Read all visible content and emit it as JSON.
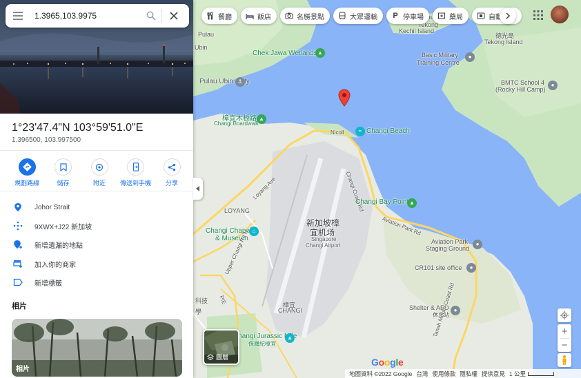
{
  "search": {
    "value": "1.3965,103.9975"
  },
  "place": {
    "title": "1°23'47.4\"N 103°59'51.0\"E",
    "decimal": "1.396500, 103.997500"
  },
  "actions": [
    {
      "label": "規劃路線",
      "icon": "directions-icon"
    },
    {
      "label": "儲存",
      "icon": "bookmark-icon"
    },
    {
      "label": "附近",
      "icon": "nearby-icon"
    },
    {
      "label": "傳送到手機",
      "icon": "send-to-phone-icon"
    },
    {
      "label": "分享",
      "icon": "share-icon"
    }
  ],
  "info": [
    {
      "text": "Johor Strait",
      "icon": "location-pin-icon"
    },
    {
      "text": "9XWX+J22 新加坡",
      "icon": "plus-code-icon"
    },
    {
      "text": "新增遺漏的地點",
      "icon": "add-place-icon"
    },
    {
      "text": "加入你的商家",
      "icon": "add-business-icon"
    },
    {
      "text": "新增標籤",
      "icon": "label-icon"
    }
  ],
  "photos": {
    "heading": "相片",
    "thumb_label": "相片"
  },
  "chips": [
    {
      "label": "餐廳",
      "icon": "restaurant-icon"
    },
    {
      "label": "飯店",
      "icon": "hotel-icon"
    },
    {
      "label": "名勝景點",
      "icon": "camera-icon"
    },
    {
      "label": "大眾運輸",
      "icon": "transit-icon"
    },
    {
      "label": "停車場",
      "icon": "parking-icon"
    },
    {
      "label": "藥局",
      "icon": "pharmacy-icon"
    },
    {
      "label": "自動提款",
      "icon": "atm-icon"
    }
  ],
  "map_labels": {
    "pulau_ubin_1": "Pulau",
    "pulau_ubin_2": "Ubin",
    "tekong_kechil_1": "Pulau",
    "tekong_kechil_2": "Tekong",
    "tekong_kechil_3": "Kechil Island",
    "tekong_cn": "德光島",
    "tekong_en": "Tekong Island",
    "chek_jawa": "Chek Jawa Wetlands",
    "ubin_jetty": "Pulau Ubin Jetty",
    "basic_military_1": "Basic Military",
    "basic_military_2": "Training Centre",
    "bmtc_1": "BMTC School 4",
    "bmtc_2": "(Rocky Hill Camp)",
    "boardwalk_cn": "樟宜木板路",
    "boardwalk_en": "Changi Boardwalk",
    "changi_beach": "Changi Beach",
    "nicoll": "Nicoll",
    "changi_coast": "Changi Coast Rd",
    "changi_bay": "Changi Bay Point",
    "aviation_park": "Aviation Park Rd",
    "loyang": "LOYANG",
    "loyang_ave": "Loyang Ave",
    "chapel_1": "Changi Chapel",
    "chapel_2": "& Museum",
    "airport_cn_1": "新加坡樟",
    "airport_cn_2": "宜机场",
    "airport_en_1": "Singapore",
    "airport_en_2": "Changi Airport",
    "staging_1": "Aviation Park",
    "staging_2": "Staging Ground",
    "cr101": "CR101 site office",
    "shelter": "Shelter & AED",
    "shelter_cn": "休息站",
    "upper_changi": "Upper Changi Rd N",
    "cn_changi": "樟宜",
    "en_changi": "CHANGI",
    "jurassic_1": "Changi Jurassic Mile",
    "jurassic_2": "侏羅紀樟宜",
    "tanah_merah": "Tanah Merah Coast Rd",
    "pie": "PIE",
    "keji": "科技",
    "xue": "學"
  },
  "layers_label": "圖層",
  "google": "Google",
  "footer": {
    "data": "地圖資料 ©2022 Google",
    "region": "台灣",
    "terms": "使用條款",
    "privacy": "隱私權",
    "feedback": "提供意見",
    "scale": "1 公里"
  },
  "colors": {
    "water": "#8ab4f8",
    "land": "#e8ebe3",
    "park": "#c9e5c0",
    "airport": "#dadce0",
    "road": "#fdd663",
    "accent": "#1a73e8",
    "pin": "#ea4335"
  }
}
